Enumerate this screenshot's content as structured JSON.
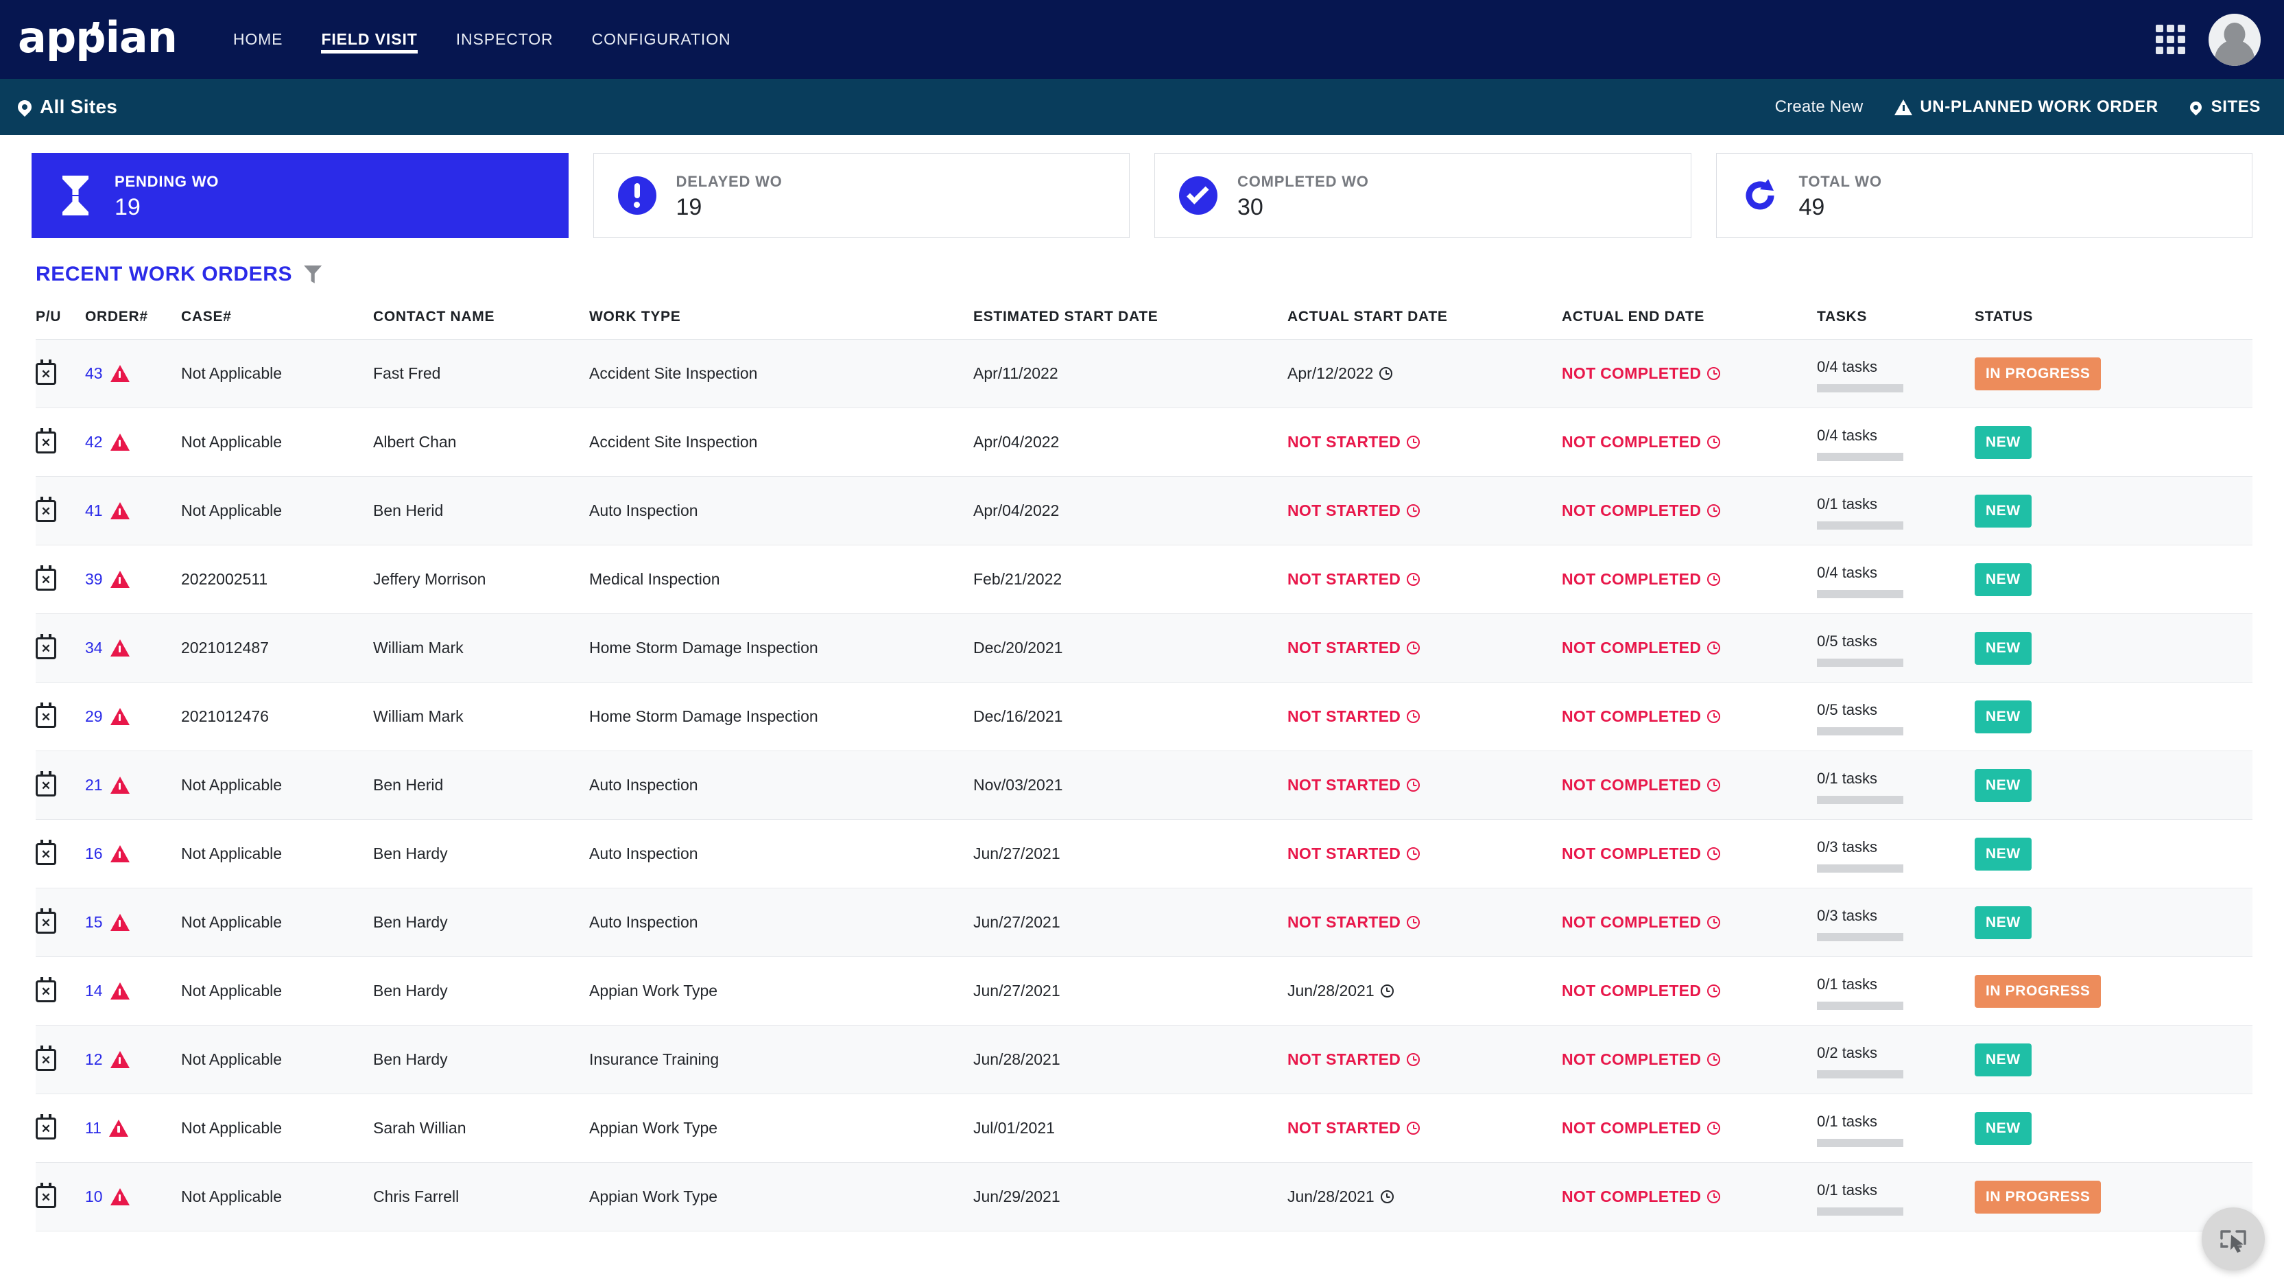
{
  "topnav": {
    "logo": "appian",
    "links": [
      {
        "label": "HOME",
        "active": false
      },
      {
        "label": "FIELD VISIT",
        "active": true
      },
      {
        "label": "INSPECTOR",
        "active": false
      },
      {
        "label": "CONFIGURATION",
        "active": false
      }
    ],
    "apps_icon": "grid-icon",
    "avatar_icon": "user-avatar-icon"
  },
  "subheader": {
    "title": "All Sites",
    "location_icon": "location-pin-icon",
    "create_new": "Create New",
    "unplanned_work_order": "UN-PLANNED WORK ORDER",
    "unplanned_icon": "warning-triangle-icon",
    "sites": "SITES",
    "sites_icon": "location-pin-icon"
  },
  "kpis": [
    {
      "label": "PENDING WO",
      "value": "19",
      "icon": "hourglass-icon",
      "selected": true
    },
    {
      "label": "DELAYED WO",
      "value": "19",
      "icon": "exclamation-circle-icon",
      "selected": false
    },
    {
      "label": "COMPLETED WO",
      "value": "30",
      "icon": "check-circle-icon",
      "selected": false
    },
    {
      "label": "TOTAL WO",
      "value": "49",
      "icon": "refresh-circle-icon",
      "selected": false
    }
  ],
  "section": {
    "title": "RECENT WORK ORDERS",
    "filter_icon": "filter-funnel-icon"
  },
  "table": {
    "columns": [
      "P/U",
      "ORDER#",
      "CASE#",
      "CONTACT NAME",
      "WORK TYPE",
      "ESTIMATED START DATE",
      "ACTUAL START DATE",
      "ACTUAL END DATE",
      "TASKS",
      "STATUS"
    ],
    "rows": [
      {
        "pu_icon": "calendar-x-icon",
        "order": "43",
        "alert_icon": "alert-triangle-icon",
        "case": "Not Applicable",
        "contact": "Fast Fred",
        "work_type": "Accident Site Inspection",
        "est_start": "Apr/11/2022",
        "act_start": "Apr/12/2022",
        "act_start_late": false,
        "act_end": "NOT COMPLETED",
        "act_end_late": true,
        "tasks": "0/4  tasks",
        "status": "IN PROGRESS",
        "status_kind": "inprogress"
      },
      {
        "pu_icon": "calendar-x-icon",
        "order": "42",
        "alert_icon": "alert-triangle-icon",
        "case": "Not Applicable",
        "contact": "Albert Chan",
        "work_type": "Accident Site Inspection",
        "est_start": "Apr/04/2022",
        "act_start": "NOT STARTED",
        "act_start_late": true,
        "act_end": "NOT COMPLETED",
        "act_end_late": true,
        "tasks": "0/4  tasks",
        "status": "NEW",
        "status_kind": "new"
      },
      {
        "pu_icon": "calendar-x-icon",
        "order": "41",
        "alert_icon": "alert-triangle-icon",
        "case": "Not Applicable",
        "contact": "Ben Herid",
        "work_type": "Auto Inspection",
        "est_start": "Apr/04/2022",
        "act_start": "NOT STARTED",
        "act_start_late": true,
        "act_end": "NOT COMPLETED",
        "act_end_late": true,
        "tasks": "0/1  tasks",
        "status": "NEW",
        "status_kind": "new"
      },
      {
        "pu_icon": "calendar-x-icon",
        "order": "39",
        "alert_icon": "alert-triangle-icon",
        "case": "2022002511",
        "contact": "Jeffery Morrison",
        "work_type": "Medical Inspection",
        "est_start": "Feb/21/2022",
        "act_start": "NOT STARTED",
        "act_start_late": true,
        "act_end": "NOT COMPLETED",
        "act_end_late": true,
        "tasks": "0/4  tasks",
        "status": "NEW",
        "status_kind": "new"
      },
      {
        "pu_icon": "calendar-x-icon",
        "order": "34",
        "alert_icon": "alert-triangle-icon",
        "case": "2021012487",
        "contact": "William Mark",
        "work_type": "Home Storm Damage Inspection",
        "est_start": "Dec/20/2021",
        "act_start": "NOT STARTED",
        "act_start_late": true,
        "act_end": "NOT COMPLETED",
        "act_end_late": true,
        "tasks": "0/5  tasks",
        "status": "NEW",
        "status_kind": "new"
      },
      {
        "pu_icon": "calendar-x-icon",
        "order": "29",
        "alert_icon": "alert-triangle-icon",
        "case": "2021012476",
        "contact": "William Mark",
        "work_type": "Home Storm Damage Inspection",
        "est_start": "Dec/16/2021",
        "act_start": "NOT STARTED",
        "act_start_late": true,
        "act_end": "NOT COMPLETED",
        "act_end_late": true,
        "tasks": "0/5  tasks",
        "status": "NEW",
        "status_kind": "new"
      },
      {
        "pu_icon": "calendar-x-icon",
        "order": "21",
        "alert_icon": "alert-triangle-icon",
        "case": "Not Applicable",
        "contact": "Ben Herid",
        "work_type": "Auto Inspection",
        "est_start": "Nov/03/2021",
        "act_start": "NOT STARTED",
        "act_start_late": true,
        "act_end": "NOT COMPLETED",
        "act_end_late": true,
        "tasks": "0/1  tasks",
        "status": "NEW",
        "status_kind": "new"
      },
      {
        "pu_icon": "calendar-x-icon",
        "order": "16",
        "alert_icon": "alert-triangle-icon",
        "case": "Not Applicable",
        "contact": "Ben Hardy",
        "work_type": "Auto Inspection",
        "est_start": "Jun/27/2021",
        "act_start": "NOT STARTED",
        "act_start_late": true,
        "act_end": "NOT COMPLETED",
        "act_end_late": true,
        "tasks": "0/3  tasks",
        "status": "NEW",
        "status_kind": "new"
      },
      {
        "pu_icon": "calendar-x-icon",
        "order": "15",
        "alert_icon": "alert-triangle-icon",
        "case": "Not Applicable",
        "contact": "Ben Hardy",
        "work_type": "Auto Inspection",
        "est_start": "Jun/27/2021",
        "act_start": "NOT STARTED",
        "act_start_late": true,
        "act_end": "NOT COMPLETED",
        "act_end_late": true,
        "tasks": "0/3  tasks",
        "status": "NEW",
        "status_kind": "new"
      },
      {
        "pu_icon": "calendar-x-icon",
        "order": "14",
        "alert_icon": "alert-triangle-icon",
        "case": "Not Applicable",
        "contact": "Ben Hardy",
        "work_type": "Appian Work Type",
        "est_start": "Jun/27/2021",
        "act_start": "Jun/28/2021",
        "act_start_late": false,
        "act_end": "NOT COMPLETED",
        "act_end_late": true,
        "tasks": "0/1  tasks",
        "status": "IN PROGRESS",
        "status_kind": "inprogress"
      },
      {
        "pu_icon": "calendar-x-icon",
        "order": "12",
        "alert_icon": "alert-triangle-icon",
        "case": "Not Applicable",
        "contact": "Ben Hardy",
        "work_type": "Insurance Training",
        "est_start": "Jun/28/2021",
        "act_start": "NOT STARTED",
        "act_start_late": true,
        "act_end": "NOT COMPLETED",
        "act_end_late": true,
        "tasks": "0/2  tasks",
        "status": "NEW",
        "status_kind": "new"
      },
      {
        "pu_icon": "calendar-x-icon",
        "order": "11",
        "alert_icon": "alert-triangle-icon",
        "case": "Not Applicable",
        "contact": "Sarah Willian",
        "work_type": "Appian Work Type",
        "est_start": "Jul/01/2021",
        "act_start": "NOT STARTED",
        "act_start_late": true,
        "act_end": "NOT COMPLETED",
        "act_end_late": true,
        "tasks": "0/1  tasks",
        "status": "NEW",
        "status_kind": "new"
      },
      {
        "pu_icon": "calendar-x-icon",
        "order": "10",
        "alert_icon": "alert-triangle-icon",
        "case": "Not Applicable",
        "contact": "Chris Farrell",
        "work_type": "Appian Work Type",
        "est_start": "Jun/29/2021",
        "act_start": "Jun/28/2021",
        "act_start_late": false,
        "act_end": "NOT COMPLETED",
        "act_end_late": true,
        "tasks": "0/1  tasks",
        "status": "IN PROGRESS",
        "status_kind": "inprogress"
      }
    ]
  },
  "fab": {
    "icon": "select-element-cursor-icon"
  },
  "colors": {
    "nav_bg": "#061650",
    "subheader_bg": "#093d5c",
    "accent_blue": "#2b2be8",
    "status_red": "#e8174a",
    "badge_inprogress": "#ed8c5b",
    "badge_new": "#1fbfa6"
  }
}
